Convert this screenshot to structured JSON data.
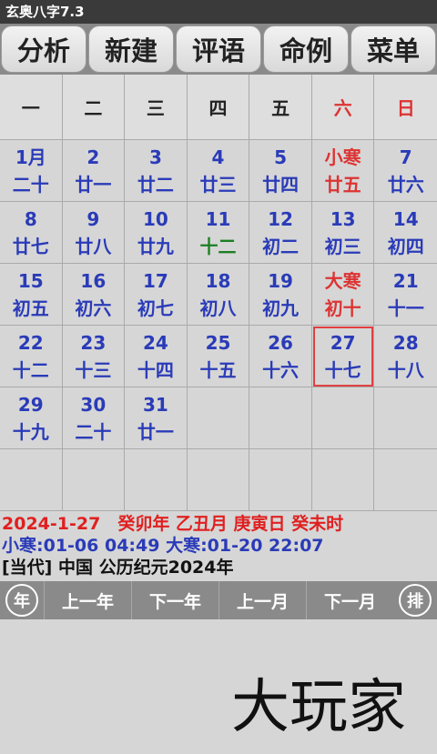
{
  "app": {
    "title": "玄奥八字7.3"
  },
  "menu": [
    "分析",
    "新建",
    "评语",
    "命例",
    "菜单"
  ],
  "weekdays": [
    "一",
    "二",
    "三",
    "四",
    "五",
    "六",
    "日"
  ],
  "cells": [
    {
      "d": "",
      "l": ""
    },
    {
      "d": "",
      "l": ""
    },
    {
      "d": "",
      "l": ""
    },
    {
      "d": "",
      "l": ""
    },
    {
      "d": "",
      "l": ""
    },
    {
      "d": "",
      "l": ""
    },
    {
      "d": "",
      "l": ""
    }
  ],
  "calendar": [
    {
      "d": "1月",
      "l": "二十"
    },
    {
      "d": "2",
      "l": "廿一"
    },
    {
      "d": "3",
      "l": "廿二"
    },
    {
      "d": "4",
      "l": "廿三"
    },
    {
      "d": "5",
      "l": "廿四"
    },
    {
      "d": "小寒",
      "l": "廿五",
      "dred": true,
      "lred": true
    },
    {
      "d": "7",
      "l": "廿六"
    },
    {
      "d": "8",
      "l": "廿七"
    },
    {
      "d": "9",
      "l": "廿八"
    },
    {
      "d": "10",
      "l": "廿九"
    },
    {
      "d": "11",
      "l": "十二",
      "lgreen": true
    },
    {
      "d": "12",
      "l": "初二"
    },
    {
      "d": "13",
      "l": "初三"
    },
    {
      "d": "14",
      "l": "初四"
    },
    {
      "d": "15",
      "l": "初五"
    },
    {
      "d": "16",
      "l": "初六"
    },
    {
      "d": "17",
      "l": "初七"
    },
    {
      "d": "18",
      "l": "初八"
    },
    {
      "d": "19",
      "l": "初九"
    },
    {
      "d": "大寒",
      "l": "初十",
      "dred": true,
      "lred": true
    },
    {
      "d": "21",
      "l": "十一"
    },
    {
      "d": "22",
      "l": "十二"
    },
    {
      "d": "23",
      "l": "十三"
    },
    {
      "d": "24",
      "l": "十四"
    },
    {
      "d": "25",
      "l": "十五"
    },
    {
      "d": "26",
      "l": "十六"
    },
    {
      "d": "27",
      "l": "十七",
      "selected": true
    },
    {
      "d": "28",
      "l": "十八"
    },
    {
      "d": "29",
      "l": "十九"
    },
    {
      "d": "30",
      "l": "二十"
    },
    {
      "d": "31",
      "l": "廿一"
    },
    {
      "d": "",
      "l": ""
    },
    {
      "d": "",
      "l": ""
    },
    {
      "d": "",
      "l": ""
    },
    {
      "d": "",
      "l": ""
    },
    {
      "d": "",
      "l": ""
    },
    {
      "d": "",
      "l": ""
    },
    {
      "d": "",
      "l": ""
    },
    {
      "d": "",
      "l": ""
    },
    {
      "d": "",
      "l": ""
    },
    {
      "d": "",
      "l": ""
    },
    {
      "d": "",
      "l": ""
    }
  ],
  "info": {
    "line1": "2024-1-27　癸卯年 乙丑月 庚寅日 癸未时",
    "line2": "小寒:01-06 04:49  大寒:01-20 22:07",
    "line3": "[当代] 中国  公历纪元2024年"
  },
  "nav": {
    "left_round": "年",
    "buttons": [
      "上一年",
      "下一年",
      "上一月",
      "下一月"
    ],
    "right_round": "排"
  },
  "logo_text": "大玩家",
  "colors": {
    "blue": "#2a3bb8",
    "red": "#d33",
    "green": "#1d7f22",
    "toolbar": "#8a8a8a"
  }
}
